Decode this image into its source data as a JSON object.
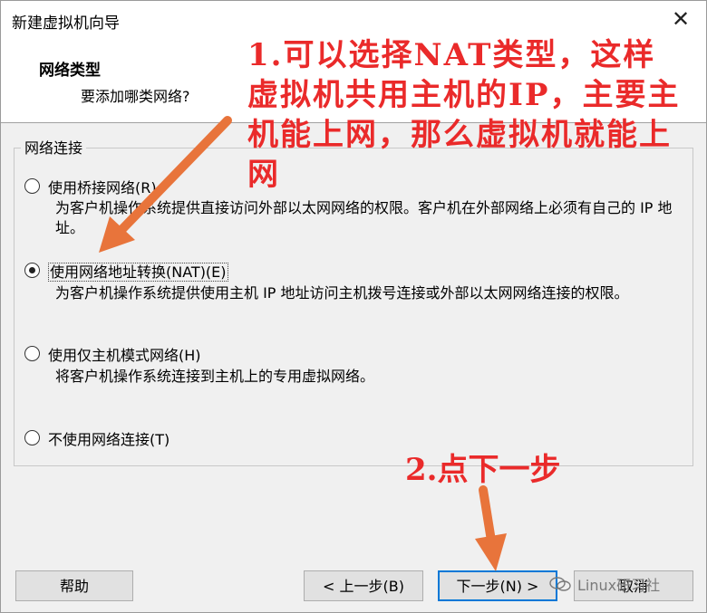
{
  "window": {
    "title": "新建虚拟机向导",
    "close_glyph": "✕"
  },
  "header": {
    "title": "网络类型",
    "subtitle": "要添加哪类网络?"
  },
  "group": {
    "label": "网络连接",
    "options": [
      {
        "label": "使用桥接网络(R)",
        "description": "为客户机操作系统提供直接访问外部以太网网络的权限。客户机在外部网络上必须有自己的 IP 地址。",
        "selected": false
      },
      {
        "label": "使用网络地址转换(NAT)(E)",
        "description": "为客户机操作系统提供使用主机 IP 地址访问主机拨号连接或外部以太网网络连接的权限。",
        "selected": true
      },
      {
        "label": "使用仅主机模式网络(H)",
        "description": "将客户机操作系统连接到主机上的专用虚拟网络。",
        "selected": false
      },
      {
        "label": "不使用网络连接(T)",
        "description": "",
        "selected": false
      }
    ]
  },
  "buttons": {
    "help": "帮助",
    "back": "< 上一步(B)",
    "next": "下一步(N) >",
    "cancel": "取消"
  },
  "annotations": {
    "note1": "1.可以选择NAT类型，这样虚拟机共用主机的IP，主要主机能上网，那么虚拟机就能上网",
    "note2": "2.点下一步",
    "color": "#ea2a2a",
    "arrow_color": "#e8743b"
  },
  "watermark": {
    "text": "Linux研习社",
    "icon": "wechat-icon"
  }
}
